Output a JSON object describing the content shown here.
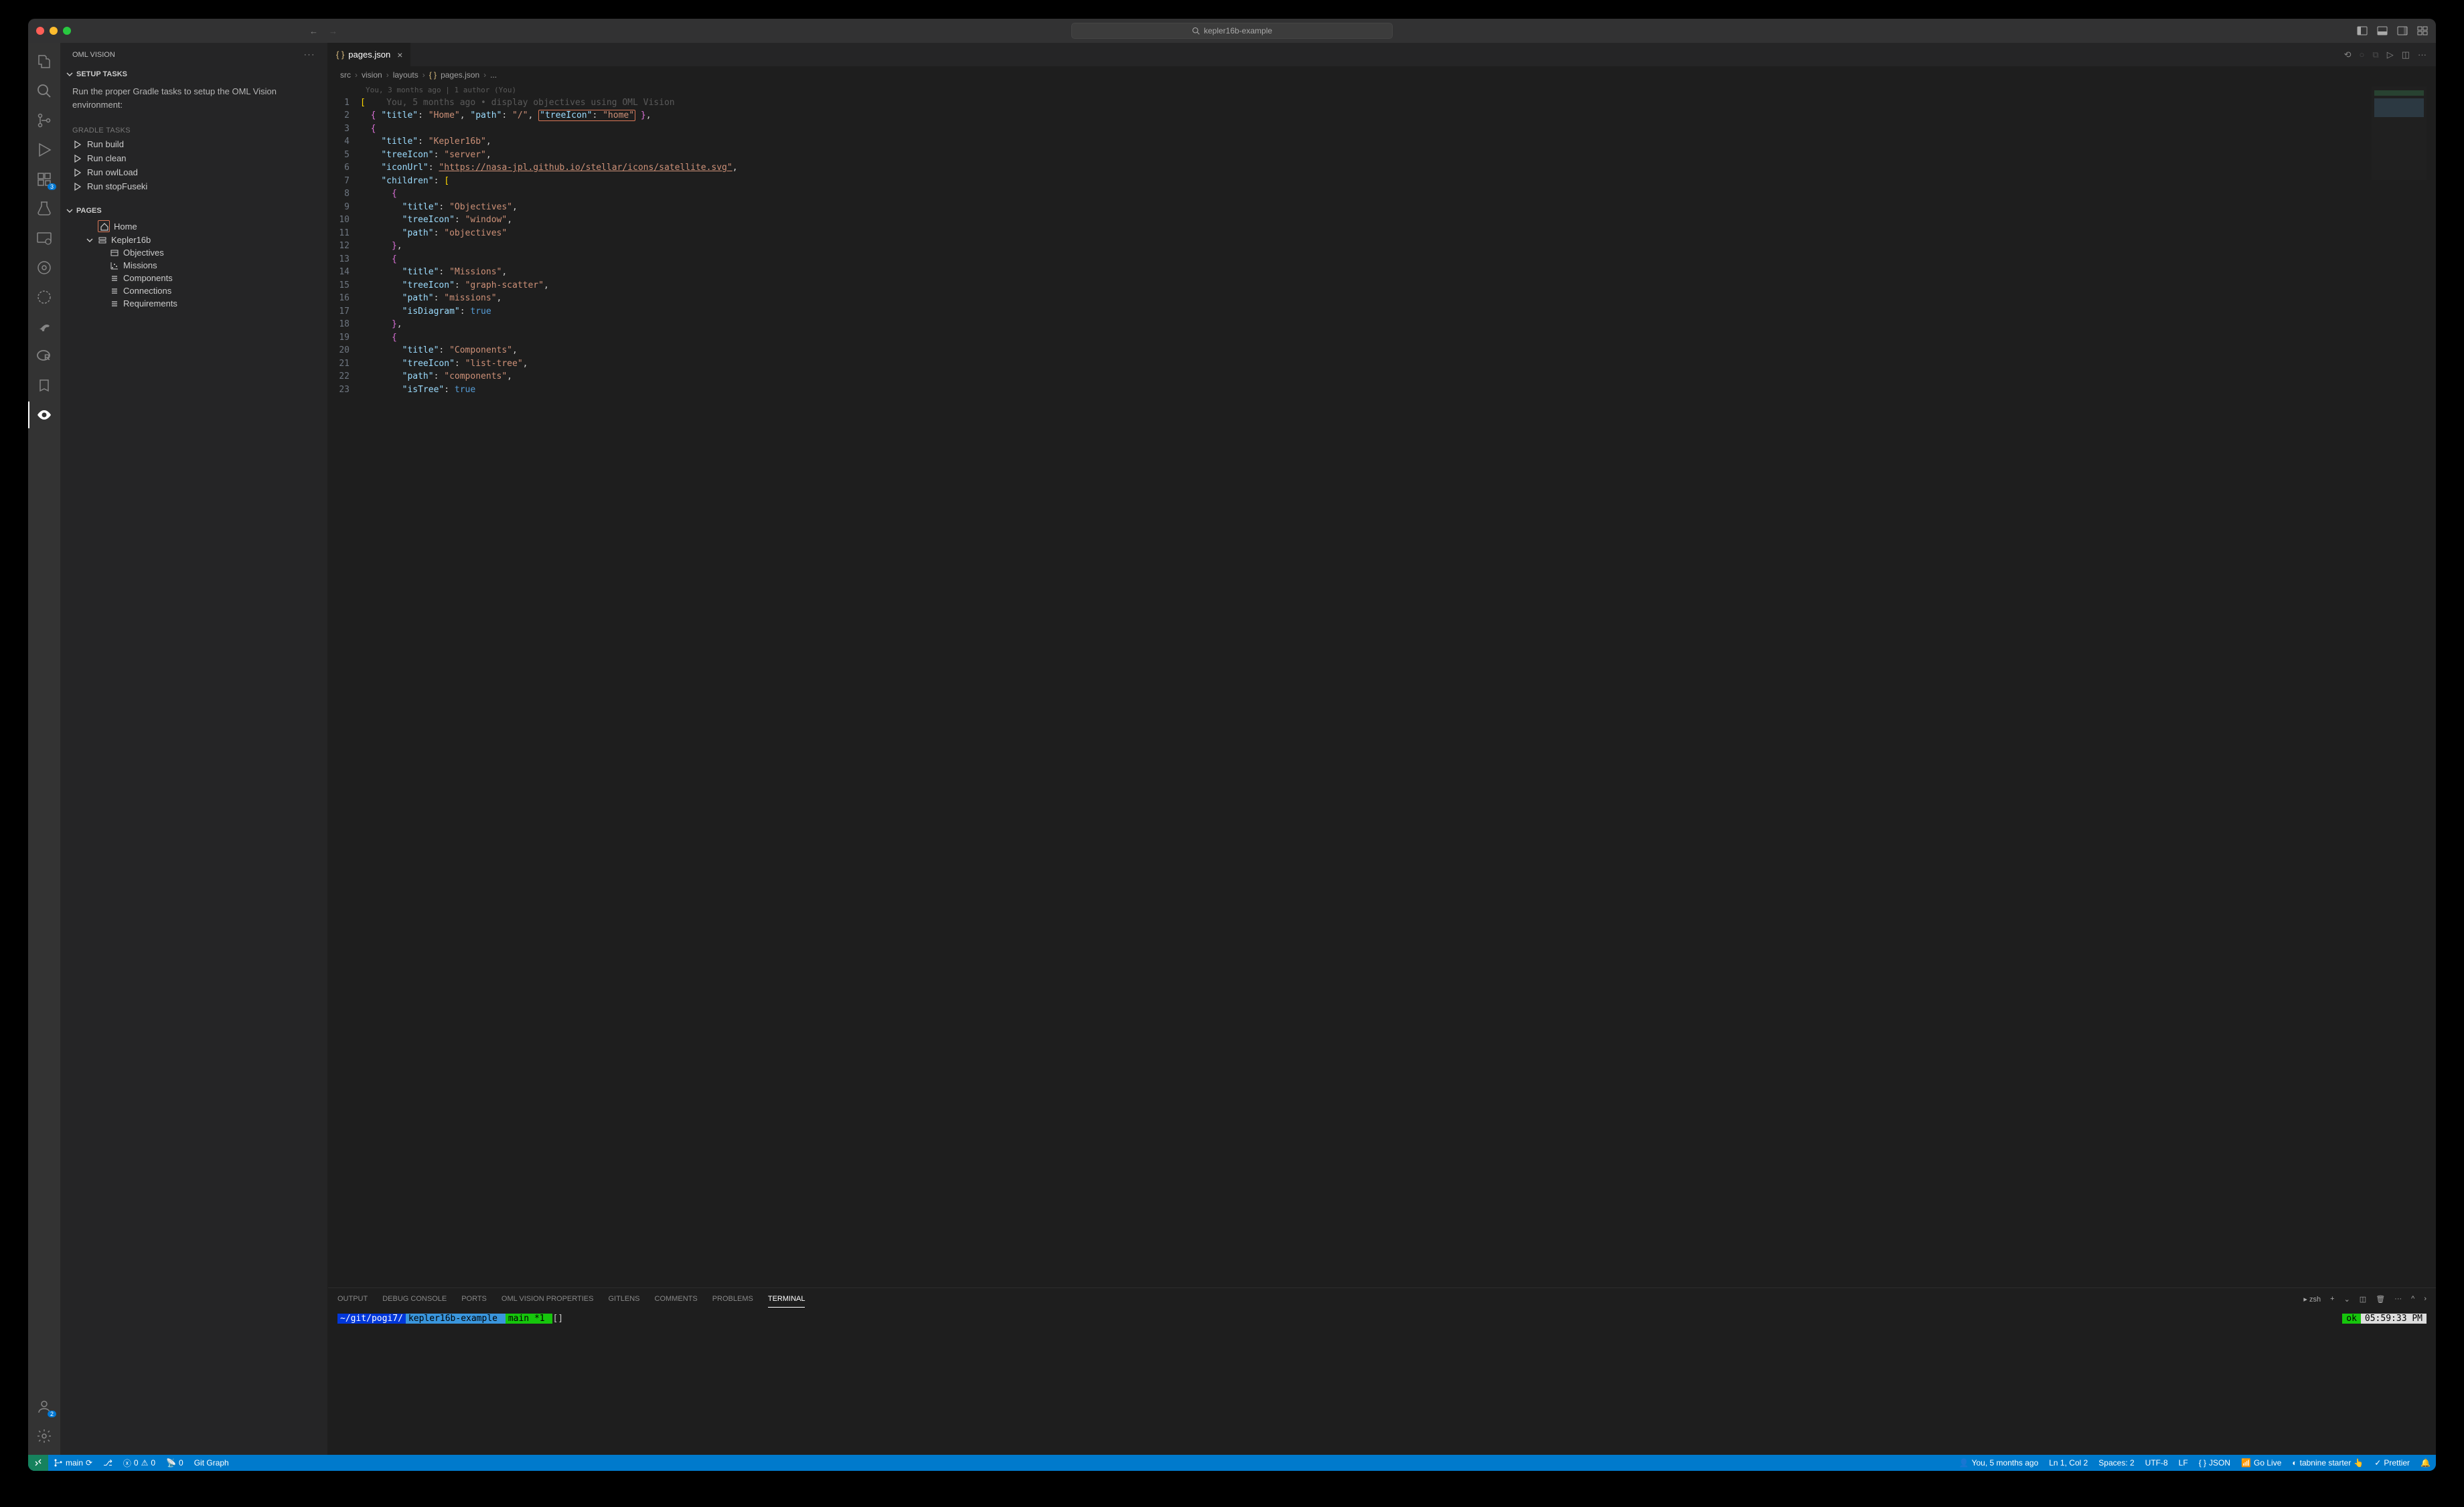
{
  "window": {
    "title": "kepler16b-example"
  },
  "sidebar": {
    "title": "OML VISION",
    "setup": {
      "heading": "SETUP TASKS",
      "description": "Run the proper Gradle tasks to setup the OML Vision environment:",
      "tasksLabel": "GRADLE TASKS",
      "tasks": [
        "Run build",
        "Run clean",
        "Run owlLoad",
        "Run stopFuseki"
      ]
    },
    "pages": {
      "heading": "PAGES",
      "items": [
        {
          "label": "Home",
          "icon": "home",
          "highlighted": true,
          "depth": 0
        },
        {
          "label": "Kepler16b",
          "icon": "server",
          "expandable": true,
          "depth": 0
        },
        {
          "label": "Objectives",
          "icon": "window",
          "depth": 1
        },
        {
          "label": "Missions",
          "icon": "graph-scatter",
          "depth": 1
        },
        {
          "label": "Components",
          "icon": "list-tree",
          "depth": 1
        },
        {
          "label": "Connections",
          "icon": "list-tree",
          "depth": 1
        },
        {
          "label": "Requirements",
          "icon": "list-tree",
          "depth": 1
        }
      ]
    }
  },
  "activity": {
    "extensionsBadge": "3",
    "accountsBadge": "2"
  },
  "editor": {
    "tab": {
      "filename": "pages.json",
      "icon": "braces"
    },
    "breadcrumb": [
      "src",
      "vision",
      "layouts",
      "pages.json",
      "..."
    ],
    "blameHeader": "You, 3 months ago | 1 author (You)",
    "inlineBlame": "You, 5 months ago • display objectives using OML Vision",
    "lines": [
      {
        "n": 1,
        "raw": "["
      },
      {
        "n": 2,
        "raw": "  { \"title\": \"Home\", \"path\": \"/\", \"treeIcon\": \"home\" },"
      },
      {
        "n": 3,
        "raw": "  {"
      },
      {
        "n": 4,
        "raw": "    \"title\": \"Kepler16b\","
      },
      {
        "n": 5,
        "raw": "    \"treeIcon\": \"server\","
      },
      {
        "n": 6,
        "raw": "    \"iconUrl\": \"https://nasa-jpl.github.io/stellar/icons/satellite.svg\","
      },
      {
        "n": 7,
        "raw": "    \"children\": ["
      },
      {
        "n": 8,
        "raw": "      {"
      },
      {
        "n": 9,
        "raw": "        \"title\": \"Objectives\","
      },
      {
        "n": 10,
        "raw": "        \"treeIcon\": \"window\","
      },
      {
        "n": 11,
        "raw": "        \"path\": \"objectives\""
      },
      {
        "n": 12,
        "raw": "      },"
      },
      {
        "n": 13,
        "raw": "      {"
      },
      {
        "n": 14,
        "raw": "        \"title\": \"Missions\","
      },
      {
        "n": 15,
        "raw": "        \"treeIcon\": \"graph-scatter\","
      },
      {
        "n": 16,
        "raw": "        \"path\": \"missions\","
      },
      {
        "n": 17,
        "raw": "        \"isDiagram\": true"
      },
      {
        "n": 18,
        "raw": "      },"
      },
      {
        "n": 19,
        "raw": "      {"
      },
      {
        "n": 20,
        "raw": "        \"title\": \"Components\","
      },
      {
        "n": 21,
        "raw": "        \"treeIcon\": \"list-tree\","
      },
      {
        "n": 22,
        "raw": "        \"path\": \"components\","
      },
      {
        "n": 23,
        "raw": "        \"isTree\": true"
      }
    ]
  },
  "panel": {
    "tabs": [
      "OUTPUT",
      "DEBUG CONSOLE",
      "PORTS",
      "OML VISION PROPERTIES",
      "GITLENS",
      "COMMENTS",
      "PROBLEMS",
      "TERMINAL"
    ],
    "activeTab": "TERMINAL",
    "shell": "zsh",
    "prompt": {
      "path1": " ~/git/pogi7/",
      "path2": "kepler16b-example ",
      "branch": " main *1 ",
      "cursor": "[]"
    },
    "status": {
      "ok": "ok",
      "time": "05:59:33 PM"
    }
  },
  "statusbar": {
    "branch": "main",
    "errors": "0",
    "warnings": "0",
    "ports": "0",
    "gitgraph": "Git Graph",
    "blame": "You, 5 months ago",
    "position": "Ln 1, Col 2",
    "spaces": "Spaces: 2",
    "encoding": "UTF-8",
    "eol": "LF",
    "lang": "JSON",
    "golive": "Go Live",
    "tabnine": "tabnine starter",
    "prettier": "Prettier"
  }
}
